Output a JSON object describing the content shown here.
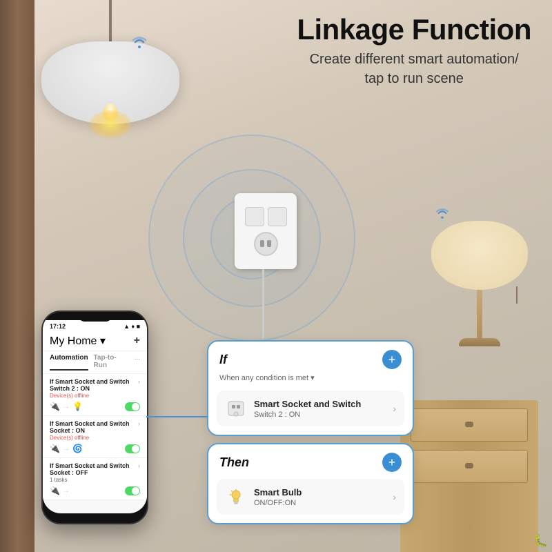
{
  "page": {
    "title_main": "Linkage Function",
    "title_sub": "Create different smart automation/\ntap to run scene"
  },
  "phone": {
    "status_time": "17:12",
    "status_icons": "● ▲ ♦",
    "home_label": "My Home ▾",
    "add_icon": "+",
    "tab_automation": "Automation",
    "tab_taptorun": "Tap-to-Run",
    "more_icon": "...",
    "items": [
      {
        "title": "If Smart Socket and Switch Switch 2 : ON",
        "sub": "Device(s) offline",
        "toggle": true
      },
      {
        "title": "If Smart Socket and Switch Socket : ON",
        "sub": "Device(s) offline",
        "toggle": true
      },
      {
        "title": "If Smart Socket and Switch Socket : OFF",
        "sub": "1 tasks",
        "toggle": true
      }
    ]
  },
  "if_card": {
    "title": "If",
    "condition": "When any condition is met ▾",
    "plus_label": "+",
    "item_title": "Smart Socket and Switch",
    "item_sub": "Switch 2 : ON"
  },
  "then_card": {
    "title": "Then",
    "plus_label": "+",
    "item_title": "Smart Bulb",
    "item_sub": "ON/OFF:ON"
  },
  "icons": {
    "wifi": "📶",
    "switch": "🔌",
    "bulb": "💡",
    "chevron_right": "›",
    "plus": "+"
  }
}
